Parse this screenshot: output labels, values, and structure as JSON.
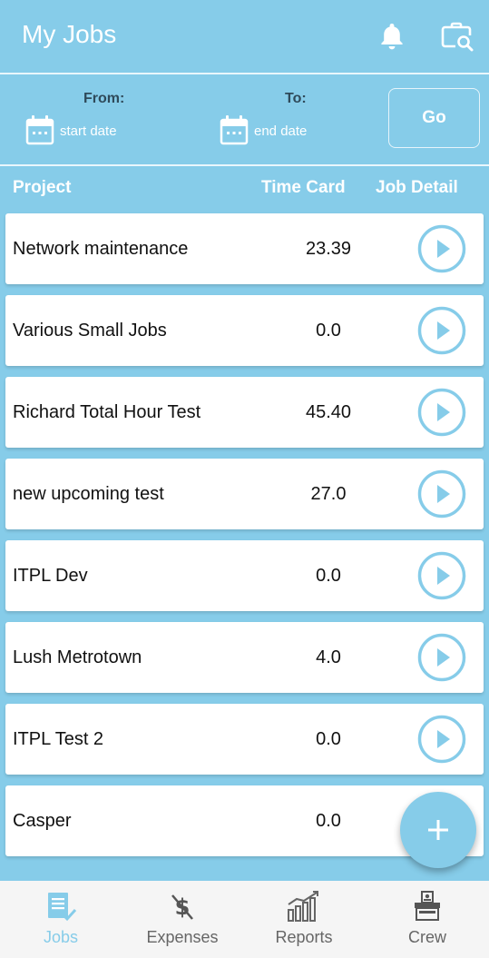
{
  "header": {
    "title": "My Jobs",
    "notifications_icon": "bell-icon",
    "search_icon": "briefcase-search-icon"
  },
  "filter": {
    "from_label": "From:",
    "to_label": "To:",
    "start_placeholder": "start date",
    "end_placeholder": "end date",
    "go_label": "Go"
  },
  "table": {
    "headers": {
      "project": "Project",
      "time_card": "Time Card",
      "job_detail": "Job Detail"
    },
    "rows": [
      {
        "project": "Network maintenance",
        "time_card": "23.39"
      },
      {
        "project": "Various Small Jobs",
        "time_card": "0.0"
      },
      {
        "project": "Richard Total Hour Test",
        "time_card": "45.40"
      },
      {
        "project": "new upcoming test",
        "time_card": "27.0"
      },
      {
        "project": "ITPL Dev",
        "time_card": "0.0"
      },
      {
        "project": "Lush Metrotown",
        "time_card": "4.0"
      },
      {
        "project": "ITPL Test 2",
        "time_card": "0.0"
      },
      {
        "project": "Casper",
        "time_card": "0.0"
      }
    ]
  },
  "fab": {
    "icon": "plus-icon"
  },
  "bottom_nav": {
    "items": [
      {
        "label": "Jobs",
        "icon": "jobs-icon",
        "active": true
      },
      {
        "label": "Expenses",
        "icon": "expenses-icon",
        "active": false
      },
      {
        "label": "Reports",
        "icon": "reports-icon",
        "active": false
      },
      {
        "label": "Crew",
        "icon": "crew-icon",
        "active": false
      }
    ]
  },
  "colors": {
    "primary": "#86cce9",
    "nav_background": "#f5f5f5",
    "nav_inactive": "#666666"
  }
}
